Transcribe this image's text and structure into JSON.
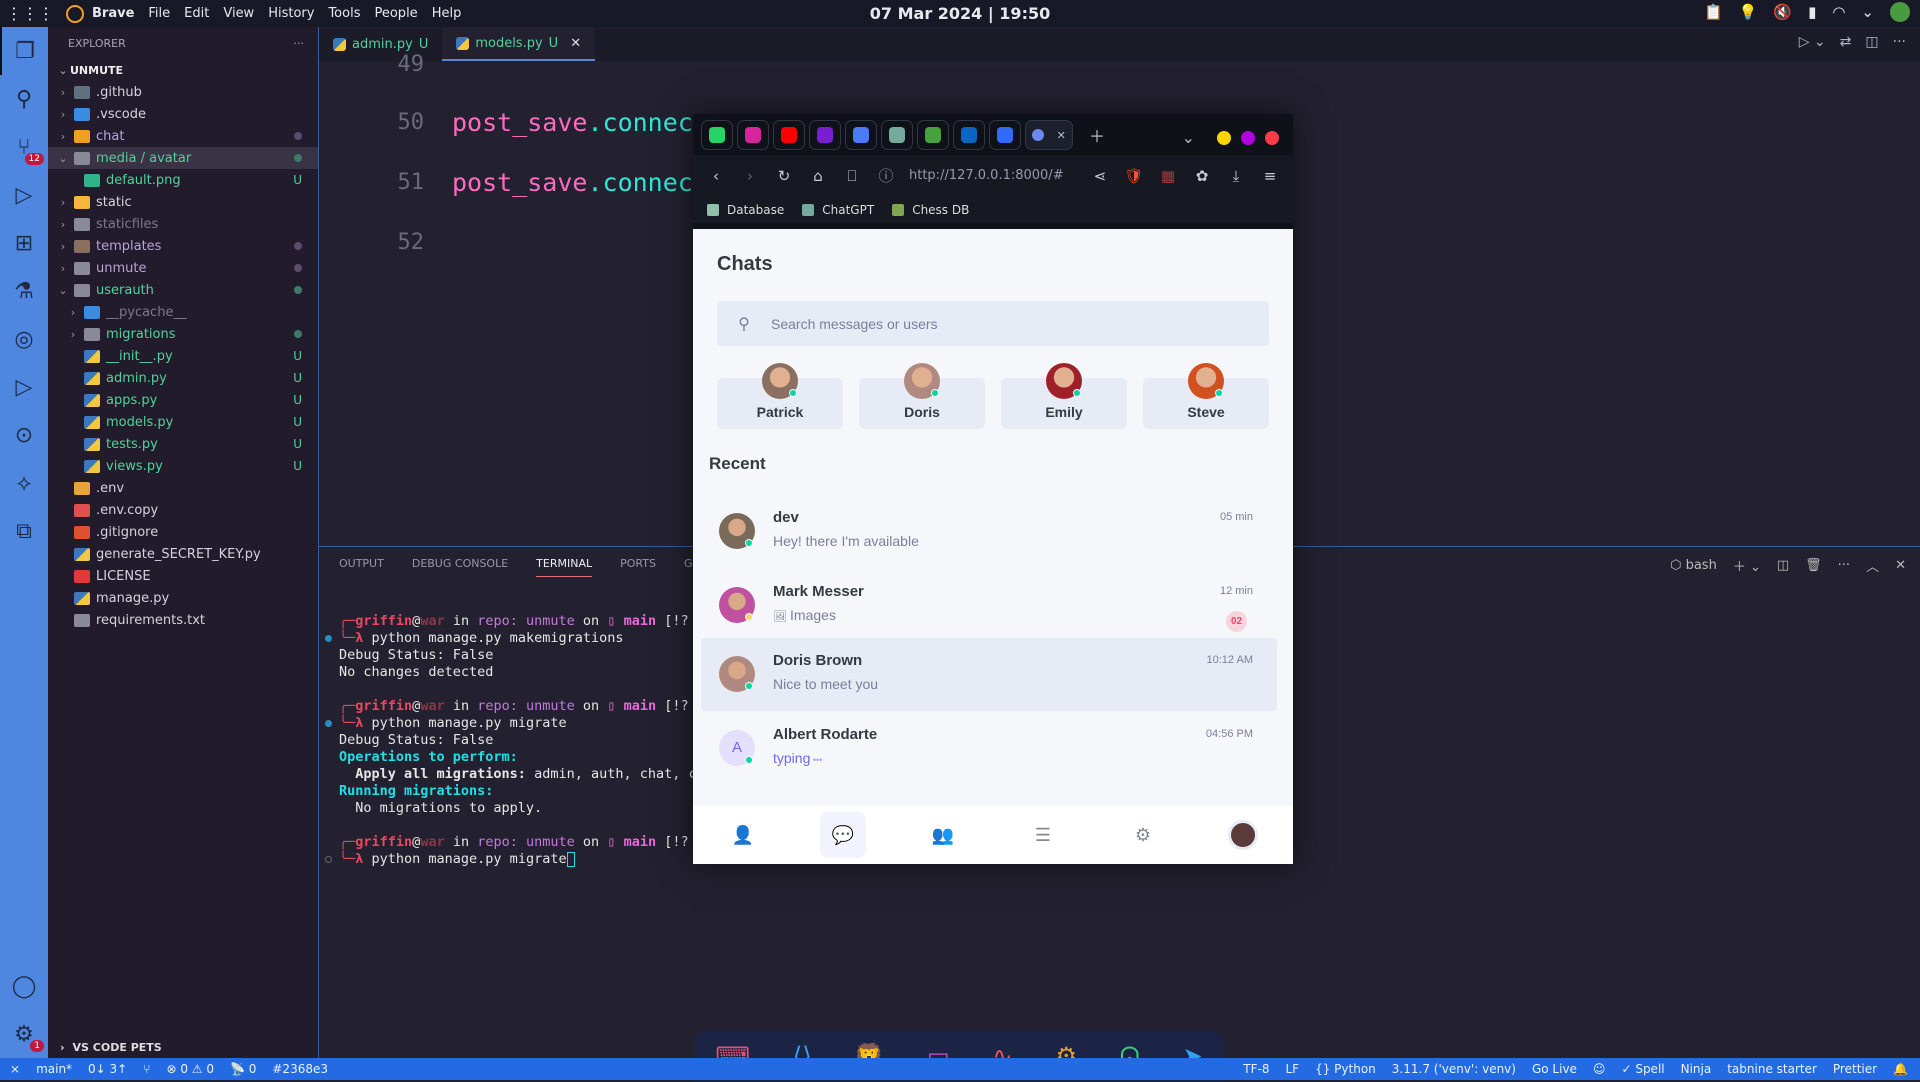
{
  "topbar": {
    "app": "Brave",
    "menus": [
      "File",
      "Edit",
      "View",
      "History",
      "Tools",
      "People",
      "Help"
    ],
    "clock": "07 Mar 2024 | 19:50"
  },
  "activity": {
    "scm_badge": "12",
    "settings_badge": "1"
  },
  "explorer": {
    "title": "EXPLORER",
    "root": "UNMUTE",
    "more": "···",
    "pets": "VS CODE PETS",
    "items": [
      {
        "label": ".github",
        "depth": 0,
        "chev": "›",
        "icon": "#607080",
        "color": "#d4d4dc"
      },
      {
        "label": ".vscode",
        "depth": 0,
        "chev": "›",
        "icon": "#3b8be0",
        "color": "#d4d4dc"
      },
      {
        "label": "chat",
        "depth": 0,
        "chev": "›",
        "icon": "#f0a020",
        "color": "#b8a4d8",
        "dot": "#5a4c6e"
      },
      {
        "label": "media / avatar",
        "depth": 0,
        "chev": "⌄",
        "icon": "#8a8a96",
        "color": "#4fd39a",
        "dot": "#3f7a68",
        "sel": true
      },
      {
        "label": "default.png",
        "depth": 1,
        "chev": "",
        "icon": "#2fb38a",
        "color": "#4fd39a",
        "status": "U"
      },
      {
        "label": "static",
        "depth": 0,
        "chev": "›",
        "icon": "#f5b83a",
        "color": "#d4d4dc"
      },
      {
        "label": "staticfiles",
        "depth": 0,
        "chev": "›",
        "icon": "#8a8a96",
        "color": "#7c7a8a"
      },
      {
        "label": "templates",
        "depth": 0,
        "chev": "›",
        "icon": "#8a6e60",
        "color": "#b8a4d8",
        "dot": "#5a4c6e"
      },
      {
        "label": "unmute",
        "depth": 0,
        "chev": "›",
        "icon": "#8a8a96",
        "color": "#b8a4d8",
        "dot": "#5a4c6e"
      },
      {
        "label": "userauth",
        "depth": 0,
        "chev": "⌄",
        "icon": "#8a8a96",
        "color": "#4fd39a",
        "dot": "#3f7a68"
      },
      {
        "label": "__pycache__",
        "depth": 1,
        "chev": "›",
        "icon": "#3b8be0",
        "color": "#7c7a8a"
      },
      {
        "label": "migrations",
        "depth": 1,
        "chev": "›",
        "icon": "#8a8a96",
        "color": "#4fd39a",
        "dot": "#3f7a68"
      },
      {
        "label": "__init__.py",
        "depth": 1,
        "chev": "",
        "icon": "py",
        "color": "#4fd39a",
        "status": "U"
      },
      {
        "label": "admin.py",
        "depth": 1,
        "chev": "",
        "icon": "py",
        "color": "#4fd39a",
        "status": "U"
      },
      {
        "label": "apps.py",
        "depth": 1,
        "chev": "",
        "icon": "py",
        "color": "#4fd39a",
        "status": "U"
      },
      {
        "label": "models.py",
        "depth": 1,
        "chev": "",
        "icon": "py",
        "color": "#4fd39a",
        "status": "U"
      },
      {
        "label": "tests.py",
        "depth": 1,
        "chev": "",
        "icon": "py",
        "color": "#4fd39a",
        "status": "U"
      },
      {
        "label": "views.py",
        "depth": 1,
        "chev": "",
        "icon": "py",
        "color": "#4fd39a",
        "status": "U"
      },
      {
        "label": ".env",
        "depth": 0,
        "chev": "",
        "icon": "#e8a33a",
        "color": "#d4d4dc"
      },
      {
        "label": ".env.copy",
        "depth": 0,
        "chev": "",
        "icon": "#e05050",
        "color": "#d4d4dc"
      },
      {
        "label": ".gitignore",
        "depth": 0,
        "chev": "",
        "icon": "#e05030",
        "color": "#d4d4dc"
      },
      {
        "label": "generate_SECRET_KEY.py",
        "depth": 0,
        "chev": "",
        "icon": "py",
        "color": "#d4d4dc"
      },
      {
        "label": "LICENSE",
        "depth": 0,
        "chev": "",
        "icon": "#e03a3a",
        "color": "#d4d4dc"
      },
      {
        "label": "manage.py",
        "depth": 0,
        "chev": "",
        "icon": "py",
        "color": "#d4d4dc"
      },
      {
        "label": "requirements.txt",
        "depth": 0,
        "chev": "",
        "icon": "#8a8a96",
        "color": "#d4d4dc"
      }
    ]
  },
  "editor": {
    "tabs": [
      {
        "label": "admin.py",
        "status": "U"
      },
      {
        "label": "models.py",
        "status": "U"
      }
    ],
    "lines": [
      {
        "n": "49",
        "code": ""
      },
      {
        "n": "50",
        "code": "post_save.connec"
      },
      {
        "n": "51",
        "code": "post_save.connec"
      },
      {
        "n": "52",
        "code": ""
      }
    ]
  },
  "panel": {
    "tabs": [
      "OUTPUT",
      "DEBUG CONSOLE",
      "TERMINAL",
      "PORTS",
      "GITLENS"
    ],
    "active": "TERMINAL",
    "shell": "bash",
    "prompt": {
      "user": "griffin",
      "at": "@",
      "host": "war",
      "in": " in ",
      "repo": "repo: unmute",
      "on": " on ",
      "branch_icon": "▯",
      "branch": "main",
      "rest": " [!?"
    },
    "blocks": [
      {
        "cmd": "python manage.py makemigrations",
        "out": [
          {
            "t": "Debug Status: False",
            "c": ""
          },
          {
            "t": "No changes detected",
            "c": ""
          }
        ],
        "mark": "#2a8fc0"
      },
      {
        "cmd": "python manage.py migrate",
        "out": [
          {
            "t": "Debug Status: False",
            "c": ""
          },
          {
            "t": "Operations to perform:",
            "c": "cy"
          },
          {
            "t": "  Apply all migrations:",
            "c": "bw",
            "tail": " admin, auth, chat, c"
          },
          {
            "t": "Running migrations:",
            "c": "cy"
          },
          {
            "t": "  No migrations to apply.",
            "c": ""
          }
        ],
        "mark": "#2a8fc0"
      },
      {
        "cmd": "python manage.py migrate",
        "out": [],
        "mark": "none",
        "cursor": true
      }
    ]
  },
  "browser": {
    "url": "http://127.0.0.1:8000/#",
    "pinned": [
      {
        "name": "whatsapp",
        "color": "#25d366"
      },
      {
        "name": "instagram",
        "color": "#d6249f"
      },
      {
        "name": "youtube",
        "color": "#ff0000"
      },
      {
        "name": "slides",
        "color": "#7a1fd0"
      },
      {
        "name": "gemini",
        "color": "#4b7bf5"
      },
      {
        "name": "chatgpt",
        "color": "#74aa9c"
      },
      {
        "name": "overleaf",
        "color": "#47a141"
      },
      {
        "name": "linkedin",
        "color": "#0a66c2"
      },
      {
        "name": "messenger",
        "color": "#2f6bf5"
      }
    ],
    "window_dots": [
      "#ffd400",
      "#b000e0",
      "#ff3b4a"
    ],
    "bookmarks": [
      {
        "label": "Database",
        "color": "#8fbfa8"
      },
      {
        "label": "ChatGPT",
        "color": "#74aa9c"
      },
      {
        "label": "Chess DB",
        "color": "#7fa650"
      }
    ]
  },
  "chat": {
    "title": "Chats",
    "search_placeholder": "Search messages or users",
    "stories": [
      {
        "name": "Patrick",
        "color": "#8a7060"
      },
      {
        "name": "Doris",
        "color": "#b08a80"
      },
      {
        "name": "Emily",
        "color": "#a0202a"
      },
      {
        "name": "Steve",
        "color": "#d05020"
      }
    ],
    "recent_label": "Recent",
    "items": [
      {
        "name": "dev",
        "msg": "Hey! there I'm available",
        "time": "05 min",
        "status": "#06d6a0",
        "av": "#7a6a5a"
      },
      {
        "name": "Mark Messer",
        "msg": "Images",
        "time": "12 min",
        "count": "02",
        "status": "#ffd166",
        "av": "#c050a0",
        "img": true
      },
      {
        "name": "Doris Brown",
        "msg": "Nice to meet you",
        "time": "10:12 AM",
        "status": "#06d6a0",
        "av": "#b08a80",
        "hl": true
      },
      {
        "name": "Albert Rodarte",
        "msg": "typing",
        "time": "04:56 PM",
        "status": "#06d6a0",
        "initial": "A",
        "typing": true
      }
    ]
  },
  "dock": [
    {
      "name": "terminal",
      "glyph": "⌨",
      "color": "#e0507a"
    },
    {
      "name": "vscode",
      "glyph": "⟨⟩",
      "color": "#3aa0f0"
    },
    {
      "name": "brave",
      "glyph": "🦁",
      "color": "#ff8a30"
    },
    {
      "name": "files",
      "glyph": "▭",
      "color": "#d050d0"
    },
    {
      "name": "monitor",
      "glyph": "∿",
      "color": "#f05060"
    },
    {
      "name": "settings",
      "glyph": "⚙",
      "color": "#e0a030"
    },
    {
      "name": "ghost",
      "glyph": "ᗣ",
      "color": "#30d080"
    },
    {
      "name": "telegram",
      "glyph": "➤",
      "color": "#30a0f0"
    }
  ],
  "status": {
    "left": [
      "main*",
      "0↓ 3↑",
      "",
      "⊗ 0 ⚠ 0",
      "📡 0",
      "#2368e3"
    ],
    "right": [
      "TF-8",
      "LF",
      "{} Python",
      "3.11.7 ('venv': venv)",
      "Go Live",
      "",
      "✓ Spell",
      "Ninja",
      "tabnine starter",
      "Prettier"
    ]
  }
}
